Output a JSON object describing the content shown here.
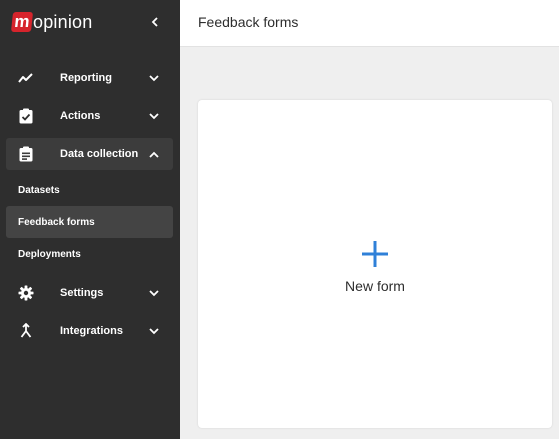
{
  "brand": {
    "logo_letter": "m",
    "logo_text": "opinion",
    "accent": "#d6242c"
  },
  "sidebar": {
    "background": "#2e2e2e",
    "items": [
      {
        "label": "Reporting",
        "icon": "trend-line-icon",
        "chevron": "down"
      },
      {
        "label": "Actions",
        "icon": "clipboard-check-icon",
        "chevron": "down"
      },
      {
        "label": "Data collection",
        "icon": "clipboard-list-icon",
        "chevron": "up",
        "expanded": true
      },
      {
        "label": "Settings",
        "icon": "gear-icon",
        "chevron": "down"
      },
      {
        "label": "Integrations",
        "icon": "merge-icon",
        "chevron": "down"
      }
    ],
    "sub_items": [
      {
        "label": "Datasets"
      },
      {
        "label": "Feedback forms",
        "selected": true
      },
      {
        "label": "Deployments"
      }
    ]
  },
  "header": {
    "title": "Feedback forms"
  },
  "main": {
    "new_form": {
      "label": "New form",
      "icon": "plus-icon",
      "icon_color": "#2f80d8"
    }
  }
}
